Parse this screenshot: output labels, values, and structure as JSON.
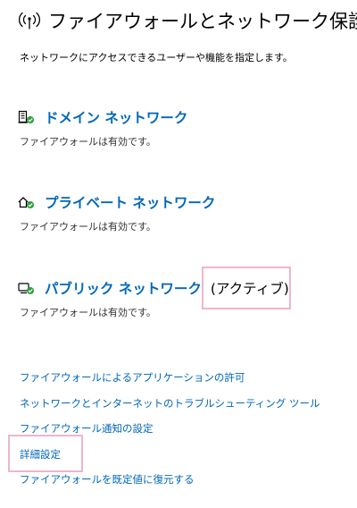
{
  "header": {
    "icon": "wifi-broadcast-icon",
    "title": "ファイアウォールとネットワーク保護",
    "subtitle": "ネットワークにアクセスできるユーザーや機能を指定します。"
  },
  "networks": [
    {
      "icon": "domain-network-icon",
      "name": "ドメイン ネットワーク",
      "status": "ファイアウォールは有効です。",
      "active_label": ""
    },
    {
      "icon": "private-network-icon",
      "name": "プライベート ネットワーク",
      "status": "ファイアウォールは有効です。",
      "active_label": ""
    },
    {
      "icon": "public-network-icon",
      "name": "パブリック ネットワーク",
      "status": "ファイアウォールは有効です。",
      "active_label": "(アクティブ)"
    }
  ],
  "links": [
    "ファイアウォールによるアプリケーションの許可",
    "ネットワークとインターネットのトラブルシューティング ツール",
    "ファイアウォール通知の設定",
    "詳細設定",
    "ファイアウォールを既定値に復元する"
  ],
  "colors": {
    "link": "#0067b8",
    "check_green": "#2e9e3a",
    "highlight": "#f0b5cc"
  }
}
